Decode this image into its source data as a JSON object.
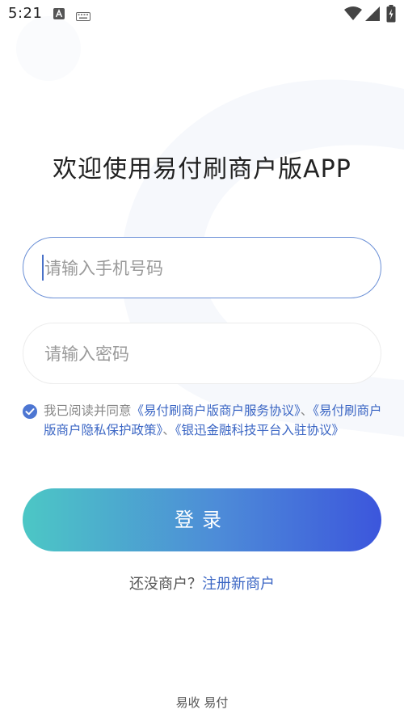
{
  "status_bar": {
    "time": "5:21"
  },
  "title": "欢迎使用易付刷商户版APP",
  "phone_input": {
    "placeholder": "请输入手机号码",
    "value": ""
  },
  "password_input": {
    "placeholder": "请输入密码",
    "value": ""
  },
  "agreement": {
    "checked": true,
    "prefix": "我已阅读并同意",
    "link_service": "《易付刷商户版商户服务协议》",
    "separator_1": "、",
    "link_privacy": "《易付刷商户版商户隐私保护政策》",
    "separator_2": "、",
    "link_platform": "《银迅金融科技平台入驻协议》"
  },
  "login_button": "登录",
  "register": {
    "question": "还没商户？",
    "link": "注册新商户"
  },
  "footer": "易收 易付",
  "colors": {
    "accent": "#4d76d2",
    "link": "#3b66c4",
    "gradient_start": "#4cc7c5",
    "gradient_end": "#3c56dc"
  }
}
